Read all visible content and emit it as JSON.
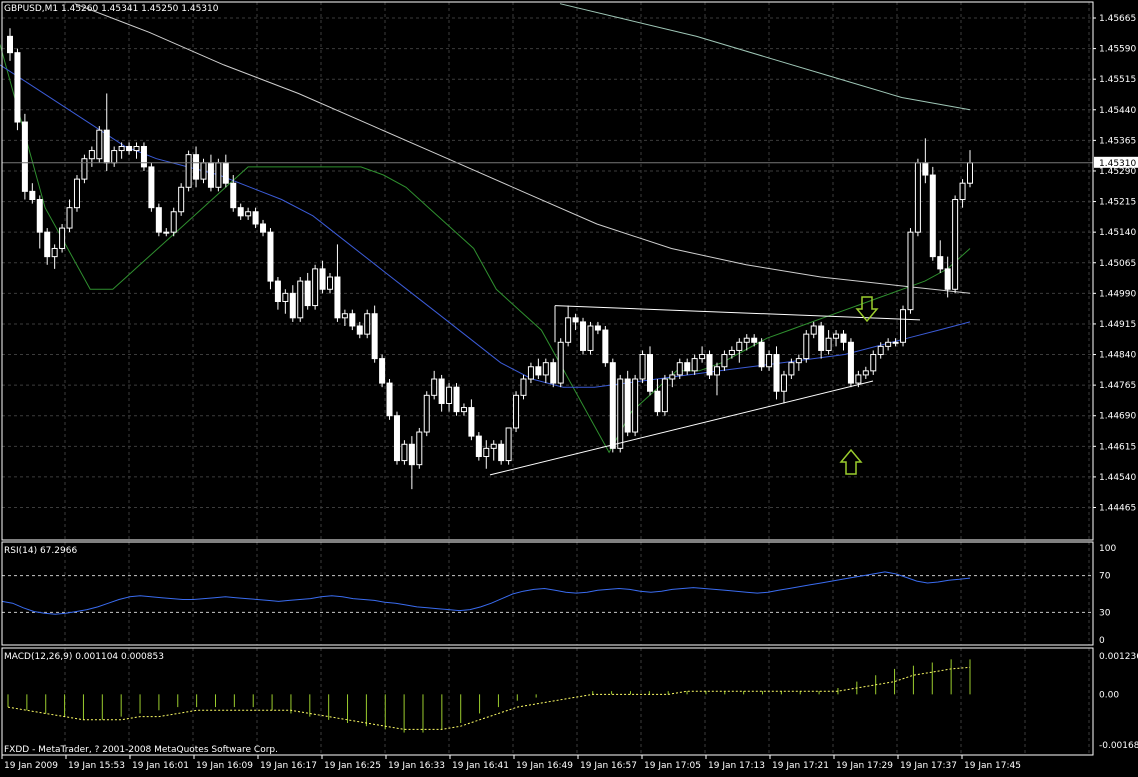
{
  "colors": {
    "background": "#000000",
    "grid": "#3c3c3c",
    "bull_candle": "#ffffff",
    "bear_candle": "#ffffff",
    "ma_fast": "#2f8f2f",
    "ma_mid": "#3b5bd6",
    "ma_slow_1": "#cfcfcf",
    "ma_slow_2": "#9fc7b7",
    "trendline": "#ffffff",
    "arrow": "#9bcd2e",
    "rsi_line": "#3a6cf0",
    "macd_hist": "#9bcd2e",
    "macd_signal": "#ffff66",
    "level_line": "#c8c8c8"
  },
  "main_panel": {
    "header": "GBPUSD,M1  1.45260 1.45341 1.45250 1.45310",
    "price_labels": [
      "1.45665",
      "1.45590",
      "1.45515",
      "1.45440",
      "1.45365",
      "1.45290",
      "1.45215",
      "1.45140",
      "1.45065",
      "1.44990",
      "1.44915",
      "1.44840",
      "1.44765",
      "1.44690",
      "1.44615",
      "1.44540",
      "1.44465"
    ],
    "current_price_label": "1.45310"
  },
  "rsi_panel": {
    "header": "RSI(14) 67.2966",
    "level_labels": [
      "100",
      "70",
      "30",
      "0"
    ]
  },
  "macd_panel": {
    "header": "MACD(12,26,9) 0.001104 0.000853",
    "level_labels": [
      "0.001236",
      "0.00",
      "-0.001685"
    ],
    "copyright": "FXDD - MetaTrader, ? 2001-2008 MetaQuotes Software Corp."
  },
  "time_labels": [
    "19 Jan 2009",
    "19 Jan 15:53",
    "19 Jan 16:01",
    "19 Jan 16:09",
    "19 Jan 16:17",
    "19 Jan 16:25",
    "19 Jan 16:33",
    "19 Jan 16:41",
    "19 Jan 16:49",
    "19 Jan 16:57",
    "19 Jan 17:05",
    "19 Jan 17:13",
    "19 Jan 17:21",
    "19 Jan 17:29",
    "19 Jan 17:37",
    "19 Jan 17:45"
  ],
  "chart_data": {
    "type": "candlestick",
    "symbol": "GBPUSD",
    "timeframe": "M1",
    "ylim": [
      1.44465,
      1.457
    ],
    "start_time": "19 Jan 15:46",
    "candles": [
      [
        1.4562,
        1.4564,
        1.4556,
        1.4558
      ],
      [
        1.4558,
        1.4559,
        1.4539,
        1.4541
      ],
      [
        1.4541,
        1.4543,
        1.4522,
        1.4524
      ],
      [
        1.4524,
        1.4526,
        1.4521,
        1.4522
      ],
      [
        1.4522,
        1.4523,
        1.451,
        1.4514
      ],
      [
        1.4514,
        1.4515,
        1.4506,
        1.4508
      ],
      [
        1.4508,
        1.4511,
        1.4505,
        1.451
      ],
      [
        1.451,
        1.4516,
        1.4509,
        1.4515
      ],
      [
        1.4515,
        1.4522,
        1.4514,
        1.452
      ],
      [
        1.452,
        1.4528,
        1.4519,
        1.4527
      ],
      [
        1.4527,
        1.4533,
        1.4526,
        1.4532
      ],
      [
        1.4532,
        1.4535,
        1.453,
        1.4534
      ],
      [
        1.4532,
        1.454,
        1.4531,
        1.4539
      ],
      [
        1.4539,
        1.4548,
        1.4529,
        1.4531
      ],
      [
        1.4531,
        1.4535,
        1.453,
        1.4534
      ],
      [
        1.4534,
        1.4536,
        1.4532,
        1.4535
      ],
      [
        1.4535,
        1.4536,
        1.4533,
        1.4534
      ],
      [
        1.4534,
        1.4536,
        1.4532,
        1.4535
      ],
      [
        1.4535,
        1.4536,
        1.4529,
        1.453
      ],
      [
        1.453,
        1.4531,
        1.4519,
        1.452
      ],
      [
        1.452,
        1.4521,
        1.4513,
        1.4514
      ],
      [
        1.4514,
        1.4515,
        1.4513,
        1.4514
      ],
      [
        1.4514,
        1.452,
        1.4513,
        1.4519
      ],
      [
        1.4519,
        1.4526,
        1.4518,
        1.4525
      ],
      [
        1.4525,
        1.4534,
        1.4524,
        1.4533
      ],
      [
        1.4533,
        1.4535,
        1.4525,
        1.4527
      ],
      [
        1.4527,
        1.4532,
        1.4526,
        1.4531
      ],
      [
        1.4531,
        1.4533,
        1.4524,
        1.4525
      ],
      [
        1.4525,
        1.4532,
        1.4524,
        1.4531
      ],
      [
        1.4531,
        1.4533,
        1.4525,
        1.4526
      ],
      [
        1.4526,
        1.4528,
        1.4519,
        1.452
      ],
      [
        1.452,
        1.4521,
        1.4517,
        1.4518
      ],
      [
        1.4518,
        1.452,
        1.4517,
        1.4519
      ],
      [
        1.4519,
        1.452,
        1.4515,
        1.4516
      ],
      [
        1.4516,
        1.4517,
        1.4513,
        1.4514
      ],
      [
        1.4514,
        1.4515,
        1.45,
        1.4502
      ],
      [
        1.4502,
        1.4503,
        1.4495,
        1.4497
      ],
      [
        1.4497,
        1.45,
        1.4494,
        1.4499
      ],
      [
        1.4499,
        1.4501,
        1.4492,
        1.4493
      ],
      [
        1.4493,
        1.4503,
        1.4492,
        1.4502
      ],
      [
        1.4502,
        1.4504,
        1.4495,
        1.4496
      ],
      [
        1.4496,
        1.4506,
        1.4495,
        1.4505
      ],
      [
        1.4505,
        1.4507,
        1.4499,
        1.45
      ],
      [
        1.45,
        1.4504,
        1.4499,
        1.4503
      ],
      [
        1.4503,
        1.4511,
        1.4492,
        1.4493
      ],
      [
        1.4493,
        1.4495,
        1.4491,
        1.4494
      ],
      [
        1.4494,
        1.4495,
        1.449,
        1.4491
      ],
      [
        1.4491,
        1.4492,
        1.4488,
        1.4489
      ],
      [
        1.4489,
        1.4495,
        1.4488,
        1.4494
      ],
      [
        1.4494,
        1.4496,
        1.4482,
        1.4483
      ],
      [
        1.4483,
        1.4484,
        1.4476,
        1.4477
      ],
      [
        1.4477,
        1.4478,
        1.4468,
        1.4469
      ],
      [
        1.4469,
        1.447,
        1.4457,
        1.4458
      ],
      [
        1.4458,
        1.4463,
        1.4457,
        1.4462
      ],
      [
        1.4462,
        1.4464,
        1.4451,
        1.4457
      ],
      [
        1.4457,
        1.4466,
        1.4456,
        1.4465
      ],
      [
        1.4465,
        1.4475,
        1.4464,
        1.4474
      ],
      [
        1.4474,
        1.448,
        1.4473,
        1.4478
      ],
      [
        1.4478,
        1.4479,
        1.447,
        1.4472
      ],
      [
        1.4472,
        1.4477,
        1.447,
        1.4476
      ],
      [
        1.4476,
        1.4477,
        1.4469,
        1.447
      ],
      [
        1.447,
        1.4472,
        1.4469,
        1.4471
      ],
      [
        1.4471,
        1.4473,
        1.4463,
        1.4464
      ],
      [
        1.4464,
        1.4465,
        1.4458,
        1.4459
      ],
      [
        1.4459,
        1.4463,
        1.4456,
        1.4461
      ],
      [
        1.4461,
        1.4463,
        1.4458,
        1.4462
      ],
      [
        1.4462,
        1.4463,
        1.4457,
        1.4458
      ],
      [
        1.4458,
        1.4466,
        1.4457,
        1.4466
      ],
      [
        1.4466,
        1.4475,
        1.4465,
        1.4474
      ],
      [
        1.4474,
        1.4479,
        1.4473,
        1.4478
      ],
      [
        1.4478,
        1.4482,
        1.4477,
        1.4481
      ],
      [
        1.4481,
        1.4483,
        1.4478,
        1.4479
      ],
      [
        1.4479,
        1.4483,
        1.4477,
        1.4482
      ],
      [
        1.4482,
        1.4483,
        1.4476,
        1.4477
      ],
      [
        1.4477,
        1.4488,
        1.4476,
        1.4487
      ],
      [
        1.4487,
        1.4496,
        1.4486,
        1.4493
      ],
      [
        1.4493,
        1.4494,
        1.449,
        1.4492
      ],
      [
        1.4492,
        1.4493,
        1.4484,
        1.4485
      ],
      [
        1.4485,
        1.4492,
        1.4484,
        1.4491
      ],
      [
        1.4491,
        1.4492,
        1.4489,
        1.449
      ],
      [
        1.449,
        1.4491,
        1.4481,
        1.4482
      ],
      [
        1.4482,
        1.4483,
        1.446,
        1.4461
      ],
      [
        1.4461,
        1.4479,
        1.446,
        1.4478
      ],
      [
        1.4478,
        1.448,
        1.4464,
        1.4465
      ],
      [
        1.4465,
        1.4479,
        1.4464,
        1.4478
      ],
      [
        1.4478,
        1.4485,
        1.4477,
        1.4484
      ],
      [
        1.4484,
        1.4486,
        1.4474,
        1.4475
      ],
      [
        1.4475,
        1.4478,
        1.4469,
        1.447
      ],
      [
        1.447,
        1.4479,
        1.4469,
        1.4478
      ],
      [
        1.4478,
        1.448,
        1.4476,
        1.4479
      ],
      [
        1.4479,
        1.4483,
        1.4478,
        1.4482
      ],
      [
        1.4482,
        1.4483,
        1.4479,
        1.448
      ],
      [
        1.448,
        1.4484,
        1.4479,
        1.4483
      ],
      [
        1.4483,
        1.4486,
        1.4482,
        1.4484
      ],
      [
        1.4484,
        1.4485,
        1.4478,
        1.4479
      ],
      [
        1.4479,
        1.4482,
        1.4474,
        1.4481
      ],
      [
        1.4481,
        1.4485,
        1.448,
        1.4484
      ],
      [
        1.4484,
        1.4486,
        1.4483,
        1.4485
      ],
      [
        1.4485,
        1.4488,
        1.4482,
        1.4487
      ],
      [
        1.4487,
        1.4489,
        1.4485,
        1.4488
      ],
      [
        1.4488,
        1.4489,
        1.4486,
        1.4487
      ],
      [
        1.4487,
        1.4488,
        1.448,
        1.4481
      ],
      [
        1.4481,
        1.4485,
        1.448,
        1.4484
      ],
      [
        1.4484,
        1.4486,
        1.4473,
        1.4475
      ],
      [
        1.4475,
        1.448,
        1.4472,
        1.4479
      ],
      [
        1.4479,
        1.4483,
        1.4478,
        1.4482
      ],
      [
        1.4482,
        1.4484,
        1.448,
        1.4483
      ],
      [
        1.4483,
        1.449,
        1.4482,
        1.4489
      ],
      [
        1.4489,
        1.4492,
        1.4488,
        1.4491
      ],
      [
        1.4491,
        1.4492,
        1.4483,
        1.4485
      ],
      [
        1.4485,
        1.449,
        1.4484,
        1.4488
      ],
      [
        1.4488,
        1.449,
        1.4486,
        1.4489
      ],
      [
        1.4489,
        1.449,
        1.4485,
        1.4487
      ],
      [
        1.4487,
        1.4488,
        1.4476,
        1.4477
      ],
      [
        1.4477,
        1.448,
        1.4476,
        1.4479
      ],
      [
        1.4479,
        1.4481,
        1.4478,
        1.448
      ],
      [
        1.448,
        1.4485,
        1.4479,
        1.4484
      ],
      [
        1.4484,
        1.4487,
        1.4483,
        1.4486
      ],
      [
        1.4486,
        1.4488,
        1.4485,
        1.4487
      ],
      [
        1.4487,
        1.4488,
        1.4486,
        1.4487
      ],
      [
        1.4487,
        1.4496,
        1.4486,
        1.4495
      ],
      [
        1.4495,
        1.4515,
        1.4494,
        1.4514
      ],
      [
        1.4514,
        1.4532,
        1.4513,
        1.4531
      ],
      [
        1.4531,
        1.4537,
        1.4526,
        1.4528
      ],
      [
        1.4528,
        1.453,
        1.4507,
        1.4508
      ],
      [
        1.4508,
        1.4512,
        1.4504,
        1.4505
      ],
      [
        1.4505,
        1.4508,
        1.4498,
        1.45
      ],
      [
        1.45,
        1.4523,
        1.4499,
        1.4522
      ],
      [
        1.4522,
        1.4527,
        1.452,
        1.4526
      ],
      [
        1.4526,
        1.45341,
        1.4525,
        1.4531
      ]
    ],
    "indicators": {
      "ma_fast": [
        1.456,
        1.454,
        1.452,
        1.451,
        1.45,
        1.45,
        1.4505,
        1.451,
        1.4515,
        1.452,
        1.4525,
        1.453,
        1.453,
        1.453,
        1.453,
        1.453,
        1.453,
        1.4528,
        1.4525,
        1.452,
        1.4515,
        1.451,
        1.45,
        1.4495,
        1.449,
        1.448,
        1.447,
        1.446,
        1.447,
        1.4475,
        1.448,
        1.448,
        1.4482,
        1.4485,
        1.4488,
        1.449,
        1.4492,
        1.4494,
        1.4496,
        1.4498,
        1.45,
        1.4502,
        1.4505,
        1.451
      ],
      "ma_mid": [
        1.4555,
        1.455,
        1.4545,
        1.454,
        1.4535,
        1.4532,
        1.453,
        1.4528,
        1.4525,
        1.4522,
        1.4518,
        1.4512,
        1.4506,
        1.45,
        1.4494,
        1.4488,
        1.4482,
        1.4478,
        1.4476,
        1.4476,
        1.4477,
        1.4478,
        1.4479,
        1.448,
        1.4481,
        1.4482,
        1.4483,
        1.4484,
        1.4486,
        1.4488,
        1.449,
        1.4492
      ],
      "ma_slow_1": [
        1.4575,
        1.457,
        1.4563,
        1.4555,
        1.4548,
        1.454,
        1.4532,
        1.4524,
        1.4516,
        1.451,
        1.4506,
        1.4503,
        1.4501,
        1.4499
      ],
      "ma_slow_2": [
        1.457,
        1.4566,
        1.4562,
        1.4557,
        1.4552,
        1.4547,
        1.4544
      ]
    },
    "trendlines": [
      {
        "from": [
          0,
          1.44545
        ],
        "to": [
          0,
          1.44775
        ],
        "label": ""
      },
      {
        "from": [
          0,
          1.4496
        ],
        "to": [
          0,
          1.4492
        ],
        "label": ""
      }
    ],
    "rsi": {
      "period": 14,
      "value": 67.2966,
      "ylim": [
        0,
        100
      ],
      "levels": [
        70,
        30
      ],
      "values": [
        42,
        40,
        35,
        31,
        29,
        28,
        29,
        31,
        33,
        36,
        40,
        44,
        47,
        48,
        47,
        46,
        45,
        44,
        44,
        45,
        46,
        47,
        46,
        45,
        44,
        43,
        42,
        43,
        44,
        45,
        47,
        48,
        47,
        45,
        44,
        43,
        41,
        40,
        38,
        36,
        35,
        34,
        33,
        32,
        33,
        36,
        40,
        45,
        50,
        53,
        55,
        56,
        54,
        52,
        51,
        52,
        54,
        55,
        56,
        55,
        53,
        52,
        53,
        55,
        56,
        57,
        56,
        55,
        54,
        53,
        52,
        51,
        52,
        54,
        56,
        58,
        60,
        62,
        64,
        66,
        68,
        70,
        72,
        74,
        72,
        68,
        64,
        62,
        63,
        65,
        66,
        67.2966
      ]
    },
    "macd": {
      "params": [
        12,
        26,
        9
      ],
      "main": 0.001104,
      "signal": 0.000853,
      "ylim": [
        -0.001685,
        0.001236
      ],
      "histogram": [
        -0.0004,
        -0.0005,
        -0.0006,
        -0.0007,
        -0.0008,
        -0.0008,
        -0.0007,
        -0.0006,
        -0.0005,
        -0.0004,
        -0.0004,
        -0.0004,
        -0.0004,
        -0.0004,
        -0.0005,
        -0.0006,
        -0.0007,
        -0.0008,
        -0.0009,
        -0.001,
        -0.0011,
        -0.0012,
        -0.0012,
        -0.0011,
        -0.0009,
        -0.0006,
        -0.0004,
        -0.0002,
        -0.0001,
        0.0,
        0.0,
        0.0001,
        0.0001,
        0.0001,
        0.0001,
        0.0001,
        0.0001,
        0.0001,
        0.0001,
        0.0001,
        0.0001,
        0.0001,
        0.0001,
        0.0001,
        0.0002,
        0.0004,
        0.0006,
        0.0008,
        0.0009,
        0.001,
        0.0011,
        0.0011
      ],
      "signal_line": [
        -0.0004,
        -0.0005,
        -0.0006,
        -0.0007,
        -0.0008,
        -0.0008,
        -0.0008,
        -0.0007,
        -0.0007,
        -0.0006,
        -0.0005,
        -0.0005,
        -0.0005,
        -0.0005,
        -0.0005,
        -0.0005,
        -0.0006,
        -0.0007,
        -0.0008,
        -0.0009,
        -0.001,
        -0.0011,
        -0.0011,
        -0.0011,
        -0.001,
        -0.0008,
        -0.0006,
        -0.0004,
        -0.0003,
        -0.0002,
        -0.0001,
        0.0,
        0.0,
        0.0,
        0.0,
        0.0,
        0.0001,
        0.0001,
        0.0001,
        0.0001,
        0.0001,
        0.0001,
        0.0001,
        0.0001,
        0.0001,
        0.0002,
        0.0003,
        0.0004,
        0.0006,
        0.0007,
        0.0008,
        0.00085
      ]
    }
  }
}
